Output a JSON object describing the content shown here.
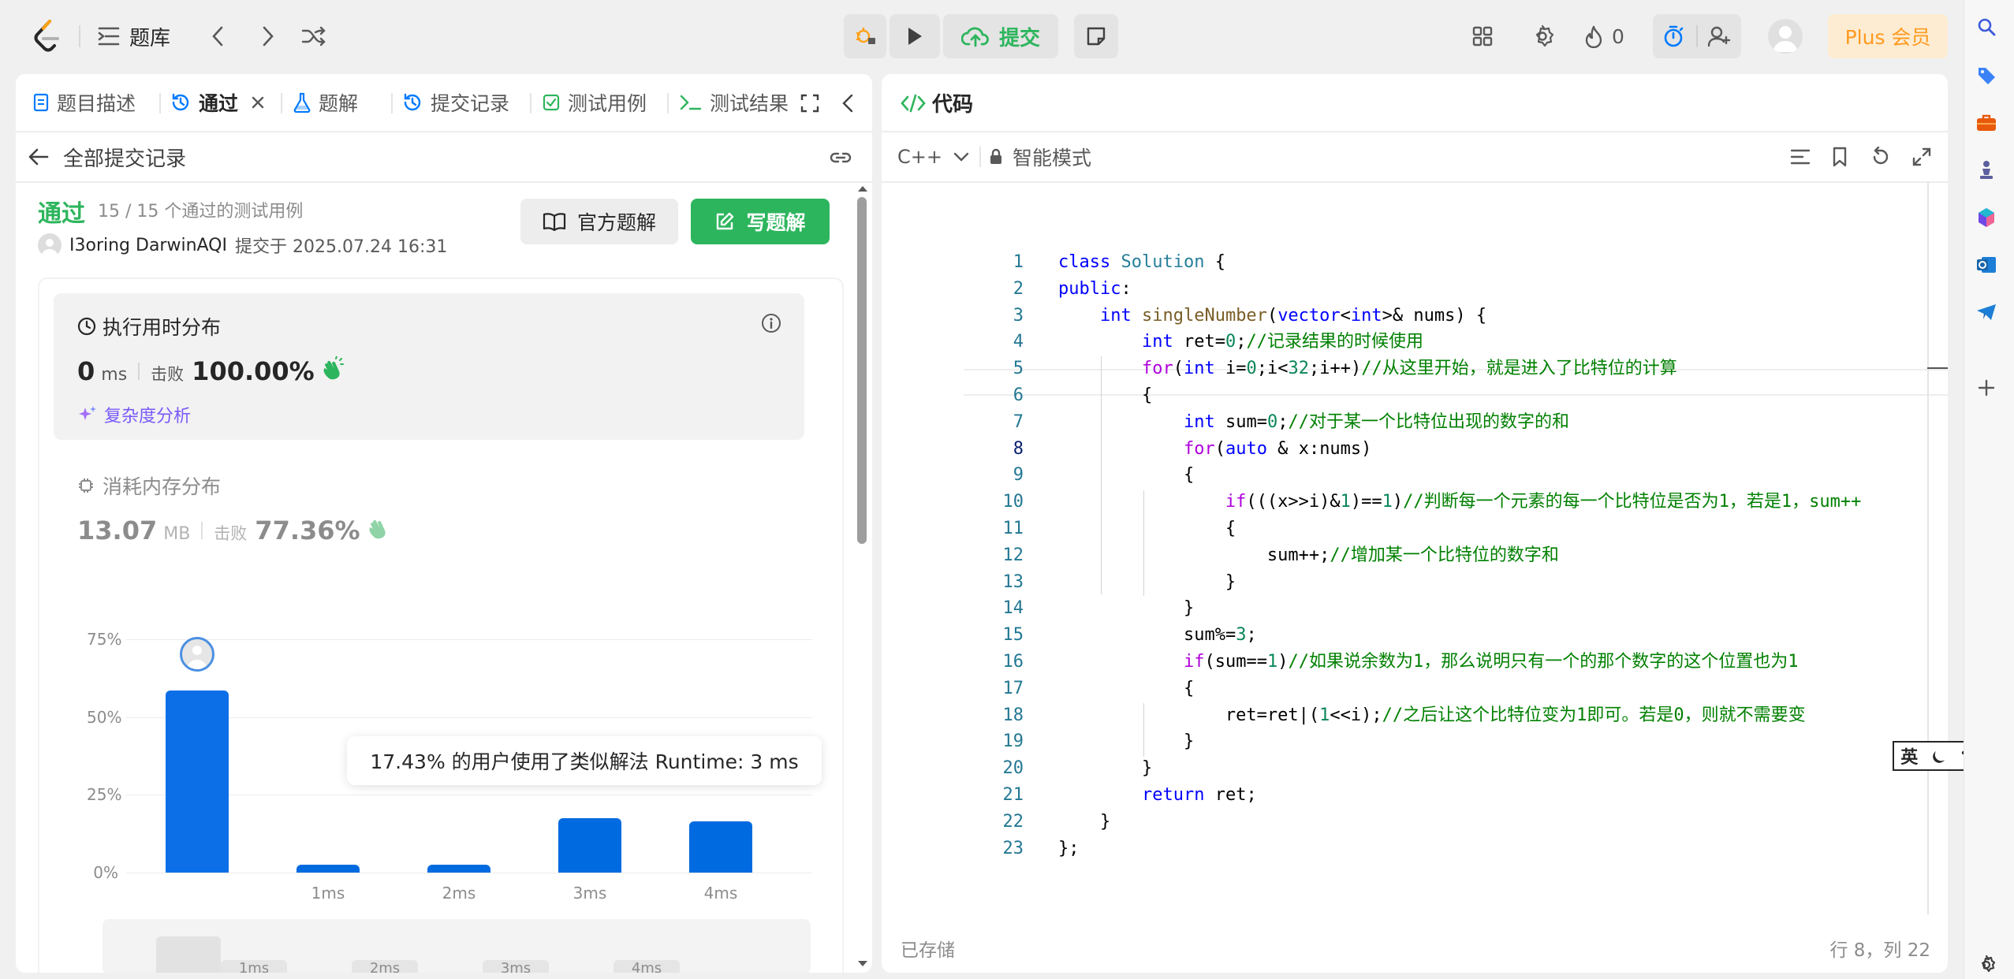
{
  "topbar": {
    "problem_list_label": "题库",
    "submit_label": "提交",
    "streak_count": "0",
    "plus_label": "Plus 会员"
  },
  "left_tabs": [
    {
      "label": "题目描述"
    },
    {
      "label": "通过"
    },
    {
      "label": "题解"
    },
    {
      "label": "提交记录"
    },
    {
      "label": "测试用例"
    },
    {
      "label": "测试结果"
    }
  ],
  "submission": {
    "back_label": "全部提交记录",
    "status": "通过",
    "testcases": "15 / 15 个通过的测试用例",
    "user": "I3oring DarwinAQI",
    "submitted_at": "提交于 2025.07.24 16:31",
    "official_solution_label": "官方题解",
    "write_solution_label": "写题解"
  },
  "runtime": {
    "title": "执行用时分布",
    "value": "0",
    "unit": "ms",
    "beats_label": "击败",
    "beats_value": "100.00%",
    "complexity_label": "复杂度分析"
  },
  "memory": {
    "title": "消耗内存分布",
    "value": "13.07",
    "unit": "MB",
    "beats_label": "击败",
    "beats_value": "77.36%"
  },
  "tooltip": "17.43% 的用户使用了类似解法 Runtime: 3 ms",
  "chart_data": {
    "type": "bar",
    "categories": [
      "0ms",
      "1ms",
      "2ms",
      "3ms",
      "4ms"
    ],
    "tick_labels": [
      "",
      "1ms",
      "2ms",
      "3ms",
      "4ms"
    ],
    "values": [
      58.5,
      2.5,
      2.5,
      17.43,
      16.5
    ],
    "yticks": [
      "0%",
      "25%",
      "50%",
      "75%"
    ],
    "ylim": [
      0,
      75
    ],
    "bar_color": "#0d6fe8",
    "bar_color_highlight": "#006ae0"
  },
  "minimap_labels": [
    "1ms",
    "2ms",
    "3ms",
    "4ms"
  ],
  "editor": {
    "title": "代码",
    "language": "C++",
    "mode_label": "智能模式",
    "saved_label": "已存储",
    "cursor_pos": "行 8，列 22",
    "ime_label": "英"
  },
  "code_lines": [
    "class Solution {",
    "public:",
    "    int singleNumber(vector<int>& nums) {",
    "        int ret=0;//记录结果的时候使用",
    "        for(int i=0;i<32;i++)//从这里开始，就是进入了比特位的计算",
    "        {",
    "            int sum=0;//对于某一个比特位出现的数字的和",
    "            for(auto & x:nums)",
    "            {",
    "                if(((x>>i)&1)==1)//判断每一个元素的每一个比特位是否为1，若是1，sum++",
    "                {",
    "                    sum++;//增加某一个比特位的数字和",
    "                }",
    "            }",
    "            sum%=3;",
    "            if(sum==1)//如果说余数为1，那么说明只有一个的那个数字的这个位置也为1",
    "            {",
    "                ret=ret|(1<<i);//之后让这个比特位变为1即可。若是0，则就不需要变",
    "            }",
    "        }",
    "        return ret;",
    "    }",
    "};"
  ]
}
